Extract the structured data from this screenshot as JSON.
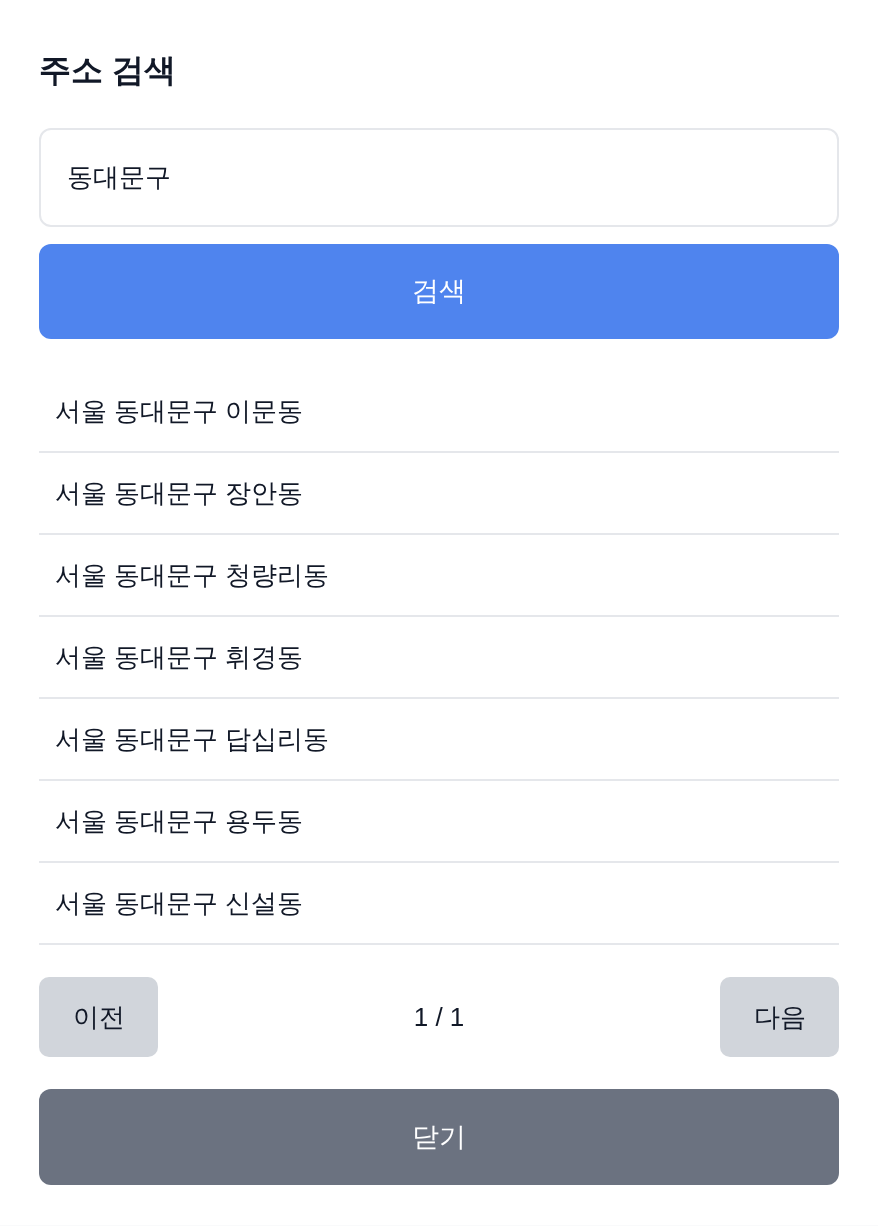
{
  "title": "주소 검색",
  "search": {
    "value": "동대문구"
  },
  "search_button": "검색",
  "results": [
    {
      "label": "서울 동대문구 이문동"
    },
    {
      "label": "서울 동대문구 장안동"
    },
    {
      "label": "서울 동대문구 청량리동"
    },
    {
      "label": "서울 동대문구 휘경동"
    },
    {
      "label": "서울 동대문구 답십리동"
    },
    {
      "label": "서울 동대문구 용두동"
    },
    {
      "label": "서울 동대문구 신설동"
    }
  ],
  "pagination": {
    "prev": "이전",
    "page": "1 / 1",
    "next": "다음"
  },
  "close_button": "닫기"
}
